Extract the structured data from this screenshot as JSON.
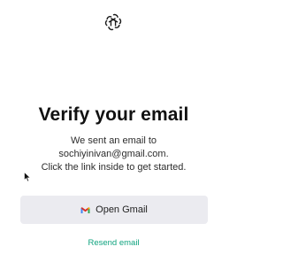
{
  "logo": {
    "icon": "openai-logo-icon"
  },
  "heading": {
    "title": "Verify your email"
  },
  "message": {
    "line1": "We sent an email to",
    "line2": "sochiyinivan@gmail.com.",
    "line3": "Click the link inside to get started."
  },
  "actions": {
    "open_gmail_label": "Open Gmail",
    "open_gmail_icon": "gmail-icon",
    "resend_label": "Resend email"
  },
  "colors": {
    "accent": "#10a37f",
    "button_bg": "#ebebf0",
    "gmail_red": "#d93025"
  }
}
